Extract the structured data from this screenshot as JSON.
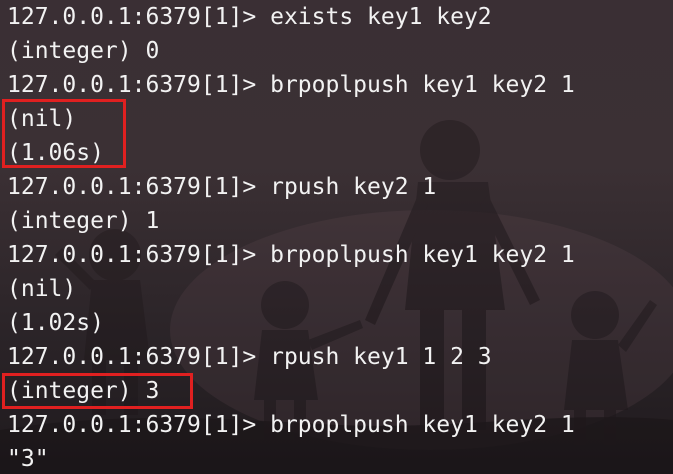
{
  "terminal": {
    "lines": [
      "127.0.0.1:6379[1]> exists key1 key2",
      "(integer) 0",
      "127.0.0.1:6379[1]> brpoplpush key1 key2 1",
      "(nil)",
      "(1.06s)",
      "127.0.0.1:6379[1]> rpush key2 1",
      "(integer) 1",
      "127.0.0.1:6379[1]> brpoplpush key1 key2 1",
      "(nil)",
      "(1.02s)",
      "127.0.0.1:6379[1]> rpush key1 1 2 3",
      "(integer) 3",
      "127.0.0.1:6379[1]> brpoplpush key1 key2 1",
      "\"3\""
    ]
  },
  "colors": {
    "text": "#f2f2f2",
    "highlight": "#e02020",
    "background": "#3a2f34"
  }
}
